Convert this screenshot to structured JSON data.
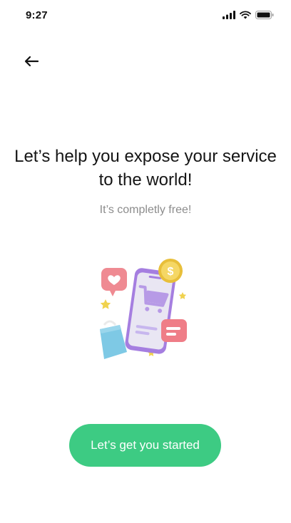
{
  "status_bar": {
    "time": "9:27"
  },
  "onboarding": {
    "headline": "Let’s help you expose your service to the world!",
    "subtitle": "It’s completly free!",
    "cta_label": "Let’s get you started"
  },
  "colors": {
    "accent": "#3dcb83",
    "subtitle_gray": "#8c8c8c",
    "phone_purple": "#b58ee6",
    "heart_pink": "#ef8a92",
    "coin_gold": "#f2cd4d",
    "bag_blue": "#7ec9e5"
  },
  "icons": {
    "back": "arrow-left-icon",
    "signal": "signal-icon",
    "wifi": "wifi-icon",
    "battery": "battery-icon"
  }
}
